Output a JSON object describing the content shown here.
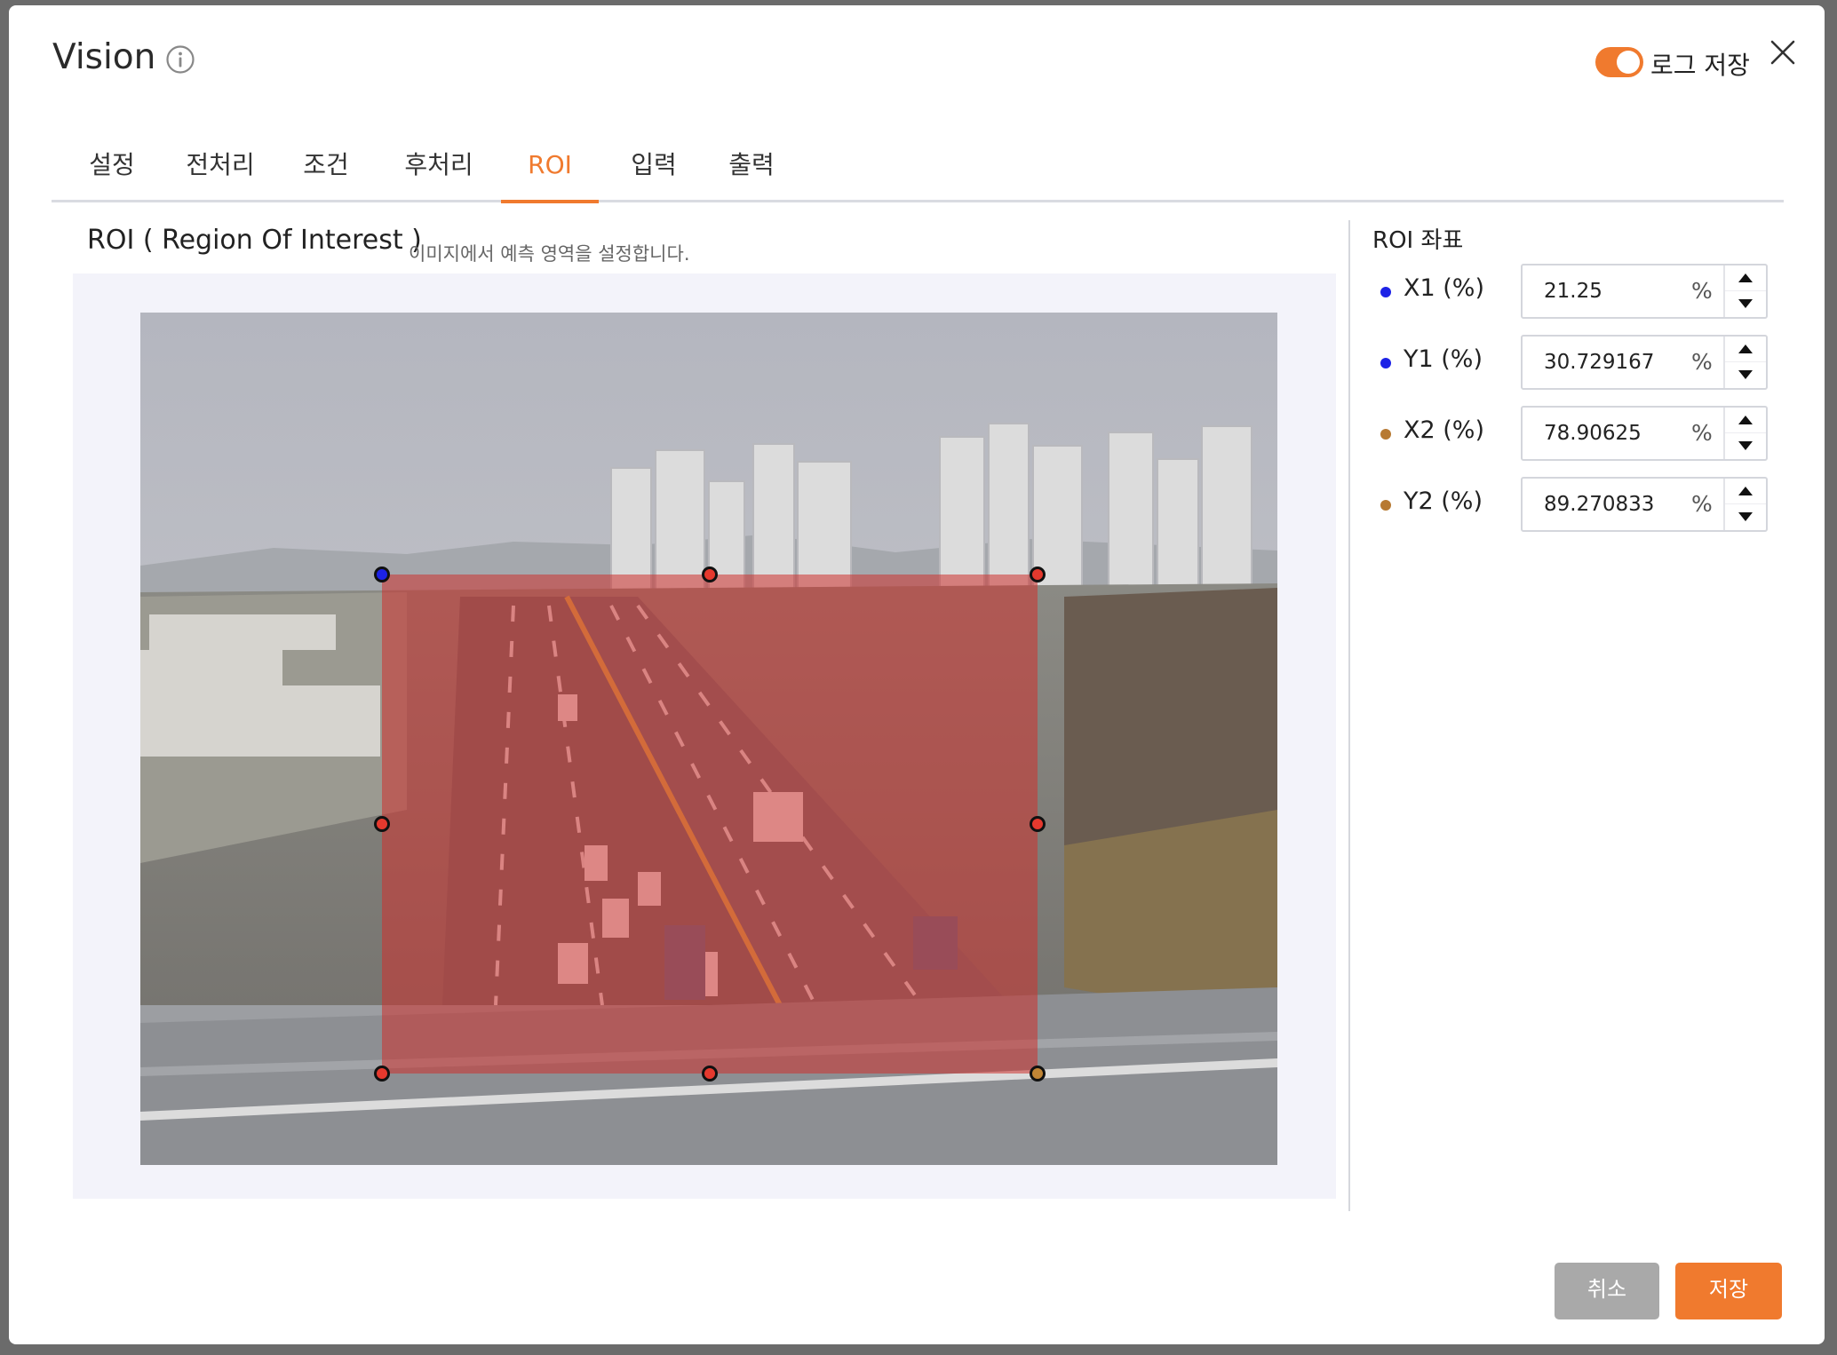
{
  "dialog": {
    "title": "Vision",
    "log_save_label": "로그 저장",
    "log_save_enabled": true
  },
  "tabs": [
    {
      "label": "설정"
    },
    {
      "label": "전처리"
    },
    {
      "label": "조건"
    },
    {
      "label": "후처리"
    },
    {
      "label": "ROI",
      "active": true
    },
    {
      "label": "입력"
    },
    {
      "label": "출력"
    }
  ],
  "section": {
    "title": "ROI ( Region Of Interest )",
    "description": "이미지에서 예측 영역을 설정합니다."
  },
  "roi_panel": {
    "title": "ROI 좌표",
    "unit": "%",
    "coords": [
      {
        "label": "X1 (%)",
        "value": "21.25",
        "dot_color": "#1d22e6"
      },
      {
        "label": "Y1 (%)",
        "value": "30.729167",
        "dot_color": "#1d22e6"
      },
      {
        "label": "X2 (%)",
        "value": "78.90625",
        "dot_color": "#b77a33"
      },
      {
        "label": "Y2 (%)",
        "value": "89.270833",
        "dot_color": "#b77a33"
      }
    ]
  },
  "buttons": {
    "cancel": "취소",
    "save": "저장"
  },
  "colors": {
    "accent": "#f07a2e",
    "roi_fill": "#cd322d",
    "handle_start": "#1d22e6",
    "handle_mid": "#e5392e",
    "handle_end": "#c08535"
  }
}
